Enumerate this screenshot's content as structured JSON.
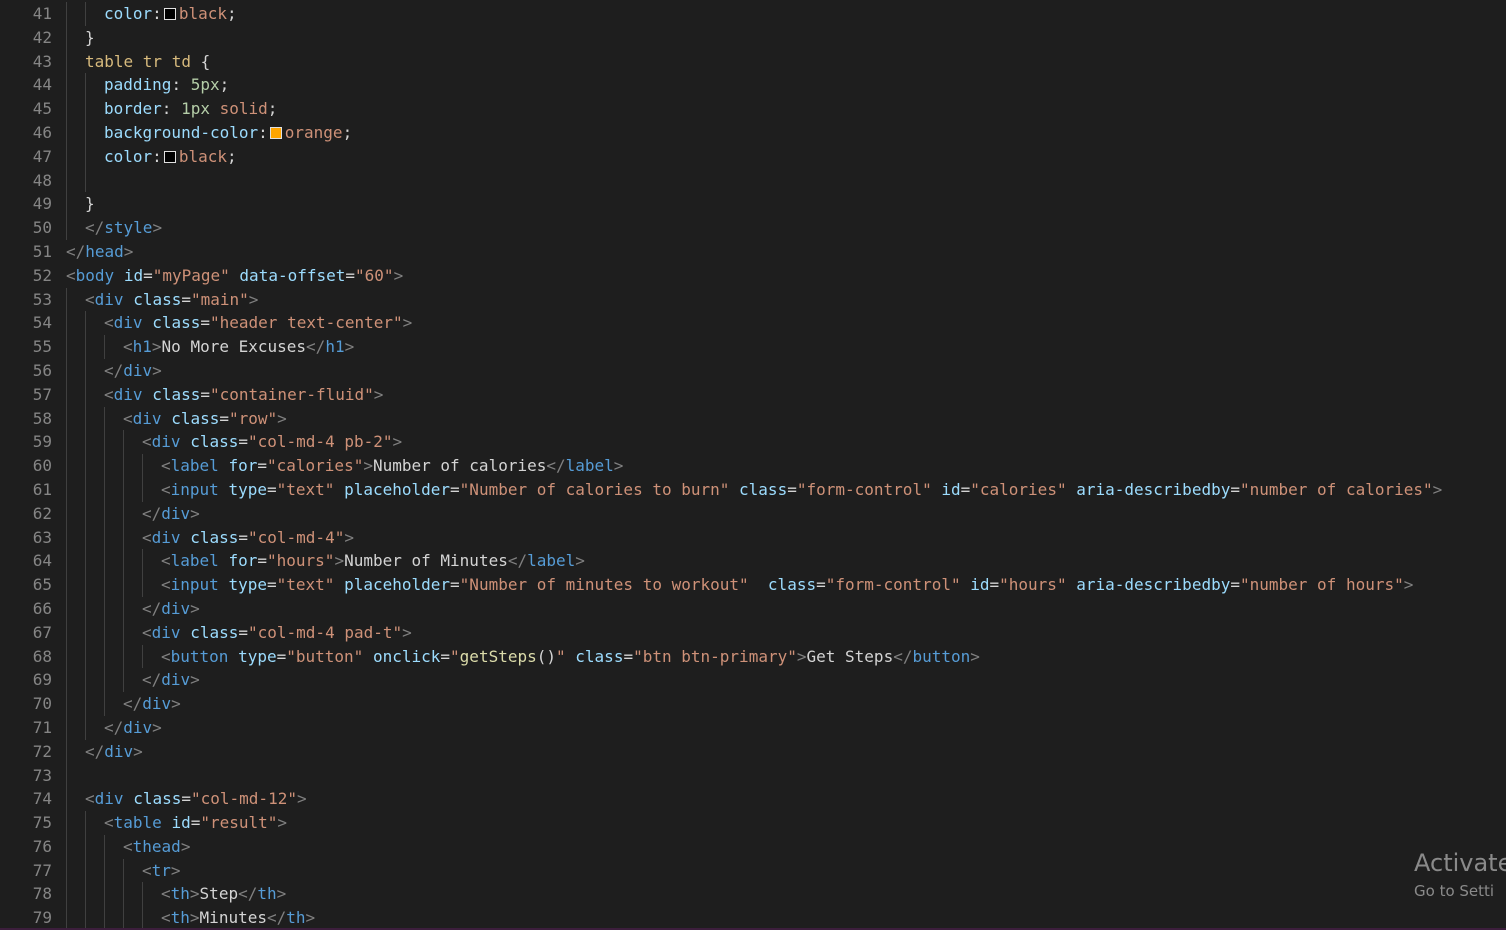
{
  "editor": {
    "theme_colors": {
      "background": "#1e1e1e",
      "line_number": "#858585",
      "tag": "#569cd6",
      "attribute": "#9cdcfe",
      "string": "#ce9178",
      "text": "#d4d4d4",
      "selector": "#d7ba7d",
      "number": "#b5cea8",
      "function": "#dcdcaa",
      "punctuation": "#808080"
    },
    "lines": [
      {
        "n": "41",
        "indent": 2,
        "tokens": [
          [
            "prop",
            "color"
          ],
          [
            "punc",
            ":"
          ],
          [
            "swatch",
            "#000000"
          ],
          [
            "val",
            "black"
          ],
          [
            "punc",
            ";"
          ]
        ]
      },
      {
        "n": "42",
        "indent": 1,
        "tokens": [
          [
            "punc",
            "}"
          ]
        ]
      },
      {
        "n": "43",
        "indent": 1,
        "tokens": [
          [
            "sel",
            "table tr td"
          ],
          [
            "punc",
            " {"
          ]
        ]
      },
      {
        "n": "44",
        "indent": 2,
        "tokens": [
          [
            "prop",
            "padding"
          ],
          [
            "punc",
            ": "
          ],
          [
            "num",
            "5px"
          ],
          [
            "punc",
            ";"
          ]
        ]
      },
      {
        "n": "45",
        "indent": 2,
        "tokens": [
          [
            "prop",
            "border"
          ],
          [
            "punc",
            ": "
          ],
          [
            "num",
            "1px"
          ],
          [
            "punc",
            " "
          ],
          [
            "val",
            "solid"
          ],
          [
            "punc",
            ";"
          ]
        ]
      },
      {
        "n": "46",
        "indent": 2,
        "tokens": [
          [
            "prop",
            "background-color"
          ],
          [
            "punc",
            ":"
          ],
          [
            "swatch",
            "#ffa500"
          ],
          [
            "val",
            "orange"
          ],
          [
            "punc",
            ";"
          ]
        ]
      },
      {
        "n": "47",
        "indent": 2,
        "tokens": [
          [
            "prop",
            "color"
          ],
          [
            "punc",
            ":"
          ],
          [
            "swatch",
            "#000000"
          ],
          [
            "val",
            "black"
          ],
          [
            "punc",
            ";"
          ]
        ]
      },
      {
        "n": "48",
        "indent": 2,
        "tokens": []
      },
      {
        "n": "49",
        "indent": 1,
        "tokens": [
          [
            "punc",
            "}"
          ]
        ]
      },
      {
        "n": "50",
        "indent": 1,
        "tokens": [
          [
            "tagp",
            "</"
          ],
          [
            "tag",
            "style"
          ],
          [
            "tagp",
            ">"
          ]
        ]
      },
      {
        "n": "51",
        "indent": 0,
        "tokens": [
          [
            "tagp",
            "</"
          ],
          [
            "tag",
            "head"
          ],
          [
            "tagp",
            ">"
          ]
        ]
      },
      {
        "n": "52",
        "indent": 0,
        "tokens": [
          [
            "tagp",
            "<"
          ],
          [
            "tag",
            "body"
          ],
          [
            "text",
            " "
          ],
          [
            "attr",
            "id"
          ],
          [
            "text",
            "="
          ],
          [
            "str",
            "\"myPage\""
          ],
          [
            "text",
            " "
          ],
          [
            "attr",
            "data-offset"
          ],
          [
            "text",
            "="
          ],
          [
            "str",
            "\"60\""
          ],
          [
            "tagp",
            ">"
          ]
        ]
      },
      {
        "n": "53",
        "indent": 1,
        "tokens": [
          [
            "tagp",
            "<"
          ],
          [
            "tag",
            "div"
          ],
          [
            "text",
            " "
          ],
          [
            "attr",
            "class"
          ],
          [
            "text",
            "="
          ],
          [
            "str",
            "\"main\""
          ],
          [
            "tagp",
            ">"
          ]
        ]
      },
      {
        "n": "54",
        "indent": 2,
        "tokens": [
          [
            "tagp",
            "<"
          ],
          [
            "tag",
            "div"
          ],
          [
            "text",
            " "
          ],
          [
            "attr",
            "class"
          ],
          [
            "text",
            "="
          ],
          [
            "str",
            "\"header text-center\""
          ],
          [
            "tagp",
            ">"
          ]
        ]
      },
      {
        "n": "55",
        "indent": 3,
        "tokens": [
          [
            "tagp",
            "<"
          ],
          [
            "tag",
            "h1"
          ],
          [
            "tagp",
            ">"
          ],
          [
            "text",
            "No More Excuses"
          ],
          [
            "tagp",
            "</"
          ],
          [
            "tag",
            "h1"
          ],
          [
            "tagp",
            ">"
          ]
        ]
      },
      {
        "n": "56",
        "indent": 2,
        "tokens": [
          [
            "tagp",
            "</"
          ],
          [
            "tag",
            "div"
          ],
          [
            "tagp",
            ">"
          ]
        ]
      },
      {
        "n": "57",
        "indent": 2,
        "tokens": [
          [
            "tagp",
            "<"
          ],
          [
            "tag",
            "div"
          ],
          [
            "text",
            " "
          ],
          [
            "attr",
            "class"
          ],
          [
            "text",
            "="
          ],
          [
            "str",
            "\"container-fluid\""
          ],
          [
            "tagp",
            ">"
          ]
        ]
      },
      {
        "n": "58",
        "indent": 3,
        "tokens": [
          [
            "tagp",
            "<"
          ],
          [
            "tag",
            "div"
          ],
          [
            "text",
            " "
          ],
          [
            "attr",
            "class"
          ],
          [
            "text",
            "="
          ],
          [
            "str",
            "\"row\""
          ],
          [
            "tagp",
            ">"
          ]
        ]
      },
      {
        "n": "59",
        "indent": 4,
        "tokens": [
          [
            "tagp",
            "<"
          ],
          [
            "tag",
            "div"
          ],
          [
            "text",
            " "
          ],
          [
            "attr",
            "class"
          ],
          [
            "text",
            "="
          ],
          [
            "str",
            "\"col-md-4 pb-2\""
          ],
          [
            "tagp",
            ">"
          ]
        ]
      },
      {
        "n": "60",
        "indent": 5,
        "tokens": [
          [
            "tagp",
            "<"
          ],
          [
            "tag",
            "label"
          ],
          [
            "text",
            " "
          ],
          [
            "attr",
            "for"
          ],
          [
            "text",
            "="
          ],
          [
            "str",
            "\"calories\""
          ],
          [
            "tagp",
            ">"
          ],
          [
            "text",
            "Number of calories"
          ],
          [
            "tagp",
            "</"
          ],
          [
            "tag",
            "label"
          ],
          [
            "tagp",
            ">"
          ]
        ]
      },
      {
        "n": "61",
        "indent": 5,
        "tokens": [
          [
            "tagp",
            "<"
          ],
          [
            "tag",
            "input"
          ],
          [
            "text",
            " "
          ],
          [
            "attr",
            "type"
          ],
          [
            "text",
            "="
          ],
          [
            "str",
            "\"text\""
          ],
          [
            "text",
            " "
          ],
          [
            "attr",
            "placeholder"
          ],
          [
            "text",
            "="
          ],
          [
            "str",
            "\"Number of calories to burn\""
          ],
          [
            "text",
            " "
          ],
          [
            "attr",
            "class"
          ],
          [
            "text",
            "="
          ],
          [
            "str",
            "\"form-control\""
          ],
          [
            "text",
            " "
          ],
          [
            "attr",
            "id"
          ],
          [
            "text",
            "="
          ],
          [
            "str",
            "\"calories\""
          ],
          [
            "text",
            " "
          ],
          [
            "attr",
            "aria-describedby"
          ],
          [
            "text",
            "="
          ],
          [
            "str",
            "\"number of calories\""
          ],
          [
            "tagp",
            ">"
          ]
        ]
      },
      {
        "n": "62",
        "indent": 4,
        "tokens": [
          [
            "tagp",
            "</"
          ],
          [
            "tag",
            "div"
          ],
          [
            "tagp",
            ">"
          ]
        ]
      },
      {
        "n": "63",
        "indent": 4,
        "tokens": [
          [
            "tagp",
            "<"
          ],
          [
            "tag",
            "div"
          ],
          [
            "text",
            " "
          ],
          [
            "attr",
            "class"
          ],
          [
            "text",
            "="
          ],
          [
            "str",
            "\"col-md-4\""
          ],
          [
            "tagp",
            ">"
          ]
        ]
      },
      {
        "n": "64",
        "indent": 5,
        "tokens": [
          [
            "tagp",
            "<"
          ],
          [
            "tag",
            "label"
          ],
          [
            "text",
            " "
          ],
          [
            "attr",
            "for"
          ],
          [
            "text",
            "="
          ],
          [
            "str",
            "\"hours\""
          ],
          [
            "tagp",
            ">"
          ],
          [
            "text",
            "Number of Minutes"
          ],
          [
            "tagp",
            "</"
          ],
          [
            "tag",
            "label"
          ],
          [
            "tagp",
            ">"
          ]
        ]
      },
      {
        "n": "65",
        "indent": 5,
        "tokens": [
          [
            "tagp",
            "<"
          ],
          [
            "tag",
            "input"
          ],
          [
            "text",
            " "
          ],
          [
            "attr",
            "type"
          ],
          [
            "text",
            "="
          ],
          [
            "str",
            "\"text\""
          ],
          [
            "text",
            " "
          ],
          [
            "attr",
            "placeholder"
          ],
          [
            "text",
            "="
          ],
          [
            "str",
            "\"Number of minutes to workout\""
          ],
          [
            "text",
            "  "
          ],
          [
            "attr",
            "class"
          ],
          [
            "text",
            "="
          ],
          [
            "str",
            "\"form-control\""
          ],
          [
            "text",
            " "
          ],
          [
            "attr",
            "id"
          ],
          [
            "text",
            "="
          ],
          [
            "str",
            "\"hours\""
          ],
          [
            "text",
            " "
          ],
          [
            "attr",
            "aria-describedby"
          ],
          [
            "text",
            "="
          ],
          [
            "str",
            "\"number of hours\""
          ],
          [
            "tagp",
            ">"
          ]
        ]
      },
      {
        "n": "66",
        "indent": 4,
        "tokens": [
          [
            "tagp",
            "</"
          ],
          [
            "tag",
            "div"
          ],
          [
            "tagp",
            ">"
          ]
        ]
      },
      {
        "n": "67",
        "indent": 4,
        "tokens": [
          [
            "tagp",
            "<"
          ],
          [
            "tag",
            "div"
          ],
          [
            "text",
            " "
          ],
          [
            "attr",
            "class"
          ],
          [
            "text",
            "="
          ],
          [
            "str",
            "\"col-md-4 pad-t\""
          ],
          [
            "tagp",
            ">"
          ]
        ]
      },
      {
        "n": "68",
        "indent": 5,
        "tokens": [
          [
            "tagp",
            "<"
          ],
          [
            "tag",
            "button"
          ],
          [
            "text",
            " "
          ],
          [
            "attr",
            "type"
          ],
          [
            "text",
            "="
          ],
          [
            "str",
            "\"button\""
          ],
          [
            "text",
            " "
          ],
          [
            "attr",
            "onclick"
          ],
          [
            "text",
            "="
          ],
          [
            "str",
            "\""
          ],
          [
            "fn",
            "getSteps"
          ],
          [
            "text",
            "()"
          ],
          [
            "str",
            "\""
          ],
          [
            "text",
            " "
          ],
          [
            "attr",
            "class"
          ],
          [
            "text",
            "="
          ],
          [
            "str",
            "\"btn btn-primary\""
          ],
          [
            "tagp",
            ">"
          ],
          [
            "text",
            "Get Steps"
          ],
          [
            "tagp",
            "</"
          ],
          [
            "tag",
            "button"
          ],
          [
            "tagp",
            ">"
          ]
        ]
      },
      {
        "n": "69",
        "indent": 4,
        "tokens": [
          [
            "tagp",
            "</"
          ],
          [
            "tag",
            "div"
          ],
          [
            "tagp",
            ">"
          ]
        ]
      },
      {
        "n": "70",
        "indent": 3,
        "tokens": [
          [
            "tagp",
            "</"
          ],
          [
            "tag",
            "div"
          ],
          [
            "tagp",
            ">"
          ]
        ]
      },
      {
        "n": "71",
        "indent": 2,
        "tokens": [
          [
            "tagp",
            "</"
          ],
          [
            "tag",
            "div"
          ],
          [
            "tagp",
            ">"
          ]
        ]
      },
      {
        "n": "72",
        "indent": 1,
        "tokens": [
          [
            "tagp",
            "</"
          ],
          [
            "tag",
            "div"
          ],
          [
            "tagp",
            ">"
          ]
        ]
      },
      {
        "n": "73",
        "indent": 1,
        "tokens": []
      },
      {
        "n": "74",
        "indent": 1,
        "tokens": [
          [
            "tagp",
            "<"
          ],
          [
            "tag",
            "div"
          ],
          [
            "text",
            " "
          ],
          [
            "attr",
            "class"
          ],
          [
            "text",
            "="
          ],
          [
            "str",
            "\"col-md-12\""
          ],
          [
            "tagp",
            ">"
          ]
        ]
      },
      {
        "n": "75",
        "indent": 2,
        "tokens": [
          [
            "tagp",
            "<"
          ],
          [
            "tag",
            "table"
          ],
          [
            "text",
            " "
          ],
          [
            "attr",
            "id"
          ],
          [
            "text",
            "="
          ],
          [
            "str",
            "\"result\""
          ],
          [
            "tagp",
            ">"
          ]
        ]
      },
      {
        "n": "76",
        "indent": 3,
        "tokens": [
          [
            "tagp",
            "<"
          ],
          [
            "tag",
            "thead"
          ],
          [
            "tagp",
            ">"
          ]
        ]
      },
      {
        "n": "77",
        "indent": 4,
        "tokens": [
          [
            "tagp",
            "<"
          ],
          [
            "tag",
            "tr"
          ],
          [
            "tagp",
            ">"
          ]
        ]
      },
      {
        "n": "78",
        "indent": 5,
        "tokens": [
          [
            "tagp",
            "<"
          ],
          [
            "tag",
            "th"
          ],
          [
            "tagp",
            ">"
          ],
          [
            "text",
            "Step"
          ],
          [
            "tagp",
            "</"
          ],
          [
            "tag",
            "th"
          ],
          [
            "tagp",
            ">"
          ]
        ]
      },
      {
        "n": "79",
        "indent": 5,
        "tokens": [
          [
            "tagp",
            "<"
          ],
          [
            "tag",
            "th"
          ],
          [
            "tagp",
            ">"
          ],
          [
            "text",
            "Minutes"
          ],
          [
            "tagp",
            "</"
          ],
          [
            "tag",
            "th"
          ],
          [
            "tagp",
            ">"
          ]
        ]
      }
    ]
  },
  "watermark": {
    "title": "Activate",
    "subtitle": "Go to Setti"
  }
}
